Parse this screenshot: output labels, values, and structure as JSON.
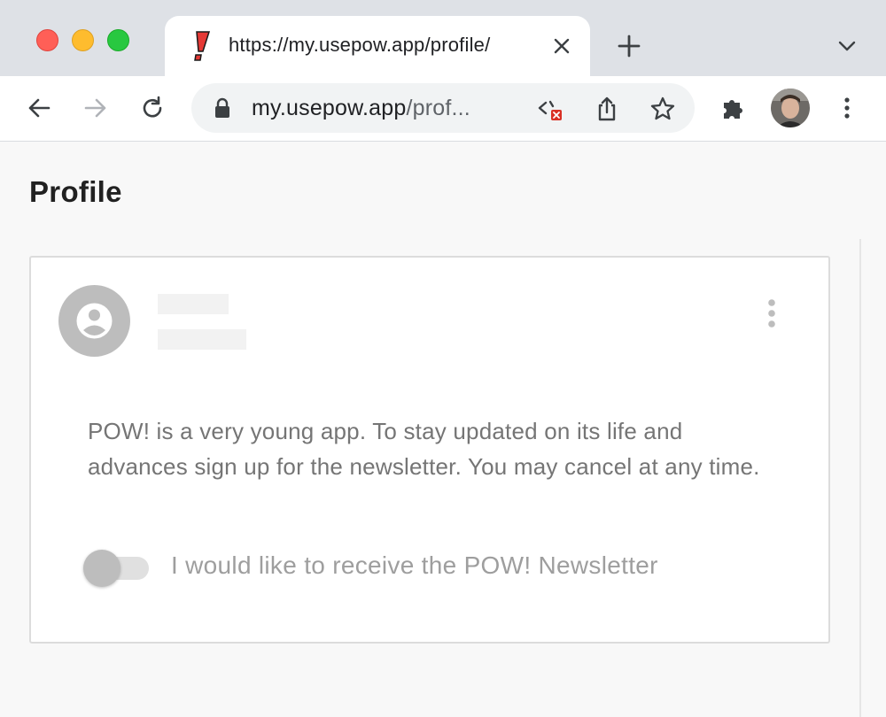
{
  "browser": {
    "tab": {
      "title": "https://my.usepow.app/profile/",
      "favicon": "pow-exclamation-icon"
    },
    "address_bar": {
      "host": "my.usepow.app",
      "path": "/prof..."
    },
    "icons": {
      "back": "back-arrow-icon",
      "forward": "forward-arrow-icon",
      "reload": "reload-icon",
      "lock": "lock-icon",
      "devtools_blocked": "code-blocked-icon",
      "share": "share-icon",
      "bookmark": "star-icon",
      "extensions": "puzzle-icon",
      "menu": "vertical-dots-icon"
    }
  },
  "page": {
    "title": "Profile",
    "card": {
      "newsletter_text": "POW! is a very young app. To stay updated on its life and advances sign up for the newsletter. You may cancel at any time.",
      "toggle_label": "I would like to receive the POW! Newsletter",
      "toggle_on": false
    }
  },
  "colors": {
    "tabstrip": "#dee1e6",
    "favicon_red": "#e53935",
    "avatar_gray": "#bdbdbd",
    "text_gray": "#757575"
  }
}
